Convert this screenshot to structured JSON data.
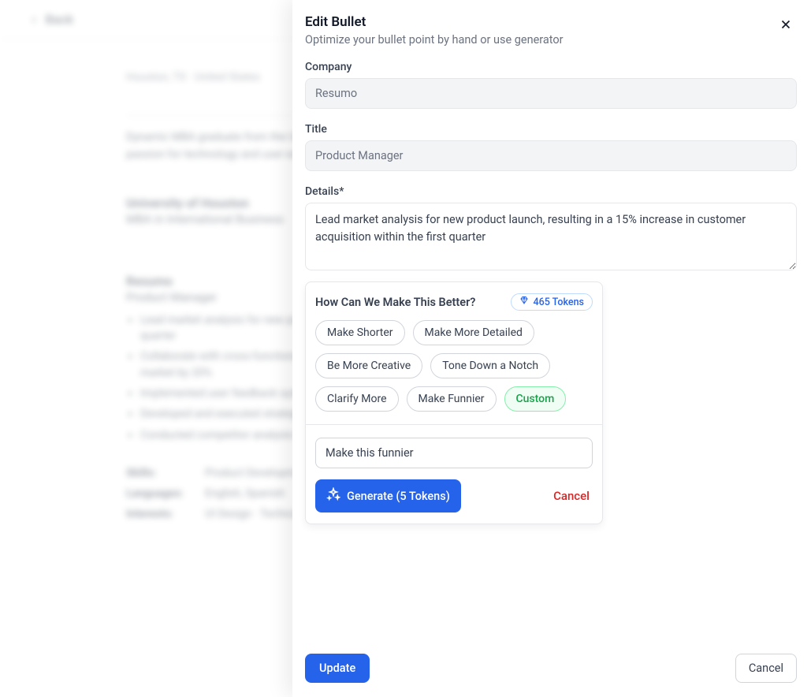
{
  "bg": {
    "back_label": "Back",
    "location": "Houston, TX · United States",
    "summary": "Dynamic MBA graduate from the University of Houston with a strong background in product management and a passion for technology and user experience. Seeking an entry-level Product Manager role in software at Google.",
    "edu_school": "University of Houston",
    "edu_degree": "MBA in International Business",
    "exp_company": "Resumo",
    "exp_title": "Product Manager",
    "bullets": [
      "Lead market analysis for new product launch, resulting in a 15% increase in customer acquisition within the first quarter",
      "Collaborate with cross-functional teams to streamline the product development process, reducing time to market by 20%",
      "Implemented user feedback system, enhancing product features based on customer insights",
      "Developed and executed strategic product roadmap aligned with company objectives",
      "Conducted competitor analysis to identify market opportunities, contributing to a 10% growth in market share"
    ],
    "skills_label": "Skills:",
    "skills_value": "Product Development · Market Research · Agile Methodologies · Competitive Analysis",
    "languages_label": "Languages:",
    "languages_value": "English, Spanish",
    "interests_label": "Interests:",
    "interests_value": "UI Design · Technology Trends · Data Visualization"
  },
  "modal": {
    "title": "Edit Bullet",
    "subtitle": "Optimize your bullet point by hand or use generator",
    "company_label": "Company",
    "company_value": "Resumo",
    "title_label": "Title",
    "title_value": "Product Manager",
    "details_label": "Details*",
    "details_value": "Lead market analysis for new product launch, resulting in a 15% increase in customer acquisition within the first quarter",
    "gen": {
      "question": "How Can We Make This Better?",
      "tokens_badge": "465 Tokens",
      "chips": [
        "Make Shorter",
        "Make More Detailed",
        "Be More Creative",
        "Tone Down a Notch",
        "Clarify More",
        "Make Funnier",
        "Custom"
      ],
      "active_chip": "Custom",
      "custom_value": "Make this funnier",
      "generate_cost": 5,
      "generate_label": "Generate (5 Tokens)",
      "cancel_label": "Cancel"
    },
    "footer": {
      "update_label": "Update",
      "cancel_label": "Cancel"
    }
  },
  "colors": {
    "primary": "#2563eb",
    "danger": "#dc2626",
    "success": "#16a34a"
  }
}
